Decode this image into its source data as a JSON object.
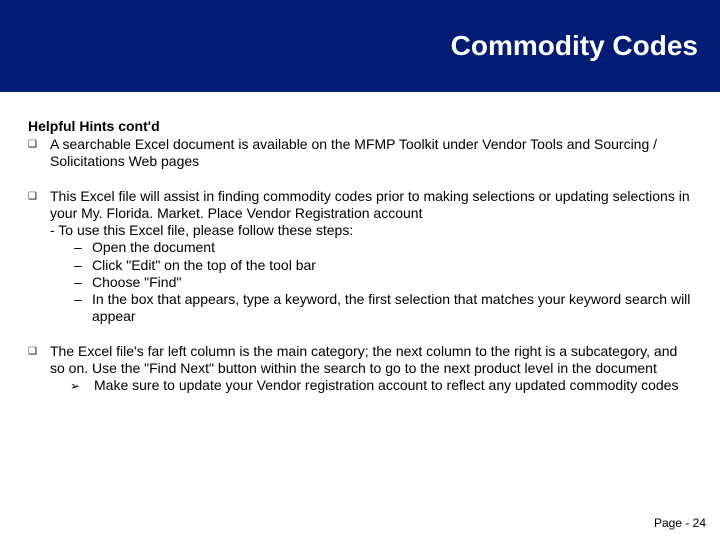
{
  "header": {
    "title": "Commodity Codes"
  },
  "section_title": "Helpful Hints cont'd",
  "bullets": {
    "b1": "A searchable Excel document is available on the MFMP Toolkit under Vendor Tools and Sourcing / Solicitations Web pages",
    "b2_main": "This Excel file will assist in finding commodity codes prior to making selections or updating selections in your My. Florida. Market. Place Vendor Registration account",
    "b2_steps_intro": "- To use this Excel file, please follow these steps:",
    "b2_s1": "Open the document",
    "b2_s2": "Click \"Edit\" on the top of the tool bar",
    "b2_s3": "Choose \"Find\"",
    "b2_s4": "In the box that appears, type a keyword, the first selection that matches your keyword search will appear",
    "b3_main": "The Excel file's far left column is the main category; the next column to the right is a subcategory, and so on. Use the \"Find Next\" button within the search to go to the next product level in the document",
    "b3_sub": "Make sure to update your Vendor registration account to reflect any updated commodity codes"
  },
  "marks": {
    "square": "❑",
    "dash": "–",
    "arrow": "➢"
  },
  "footer": {
    "page_label": "Page -  24"
  }
}
